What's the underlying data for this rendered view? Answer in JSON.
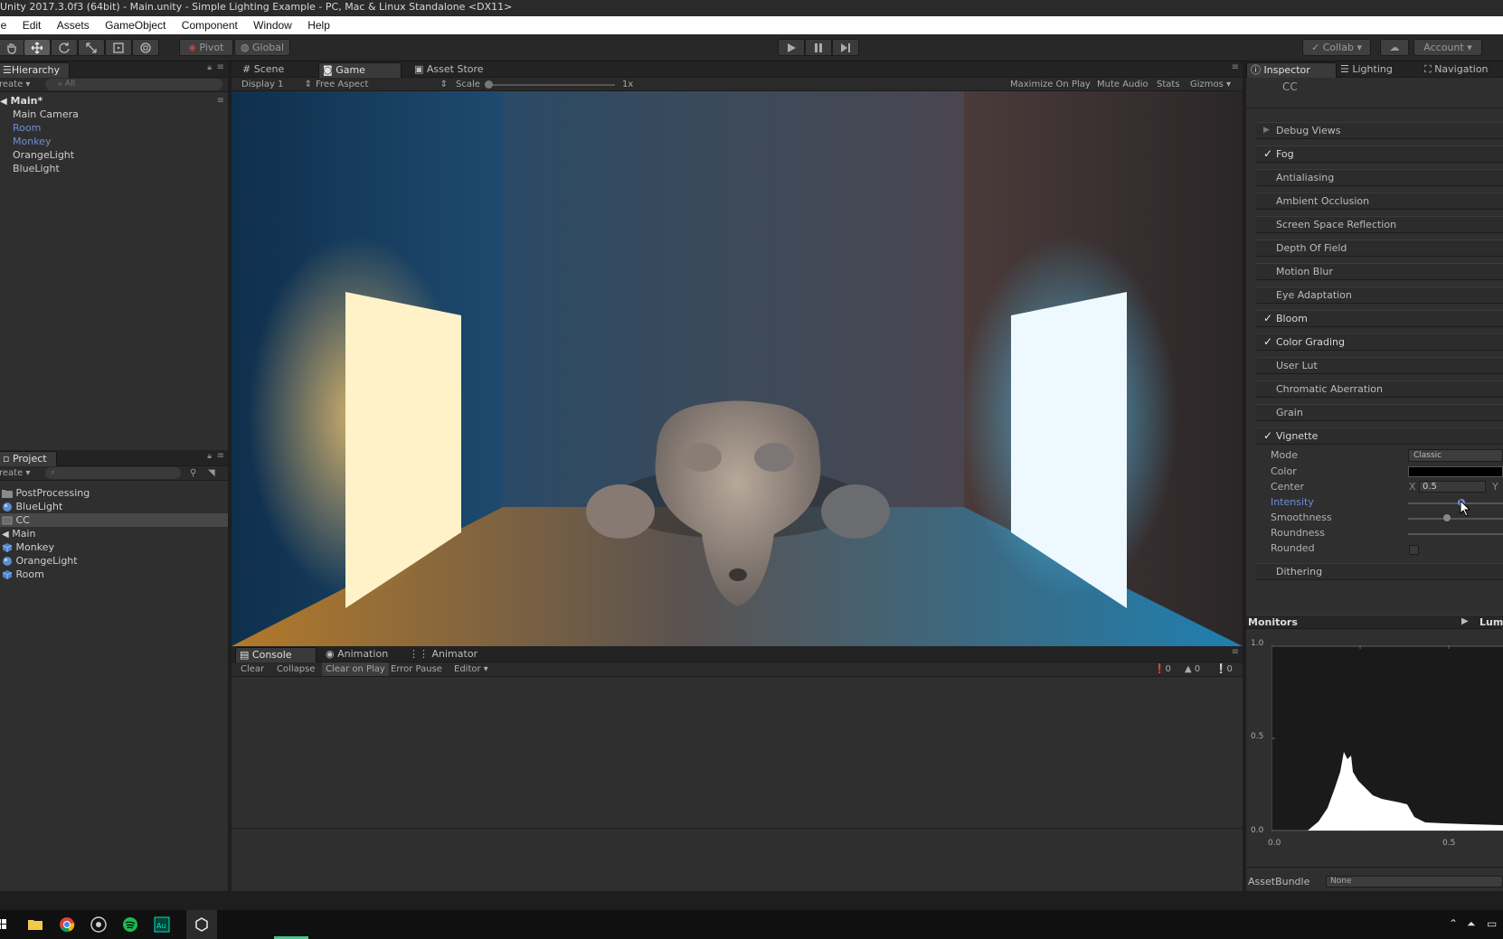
{
  "window": {
    "title": "Unity 2017.3.0f3 (64bit) - Main.unity - Simple Lighting Example - PC, Mac & Linux Standalone <DX11>"
  },
  "menu": [
    "le",
    "Edit",
    "Assets",
    "GameObject",
    "Component",
    "Window",
    "Help"
  ],
  "toolbar": {
    "pivot_label": "Pivot",
    "global_label": "Global",
    "collab_label": "Collab",
    "account_label": "Account"
  },
  "hierarchy": {
    "tab_label": "Hierarchy",
    "create_label": "reate",
    "search_placeholder": "All",
    "scene_name": "Main*",
    "items": [
      {
        "label": "Main Camera",
        "prefab": false
      },
      {
        "label": "Room",
        "prefab": true
      },
      {
        "label": "Monkey",
        "prefab": true
      },
      {
        "label": "OrangeLight",
        "prefab": false
      },
      {
        "label": "BlueLight",
        "prefab": false
      }
    ]
  },
  "project": {
    "tab_label": "Project",
    "create_label": "reate",
    "items": [
      {
        "label": "PostProcessing",
        "icon": "folder-icon"
      },
      {
        "label": "BlueLight",
        "icon": "material-icon"
      },
      {
        "label": "CC",
        "icon": "postprocess-profile-icon",
        "selected": true
      },
      {
        "label": "Main",
        "icon": "unity-scene-icon"
      },
      {
        "label": "Monkey",
        "icon": "prefab-icon"
      },
      {
        "label": "OrangeLight",
        "icon": "material-icon"
      },
      {
        "label": "Room",
        "icon": "prefab-icon"
      }
    ]
  },
  "view_tabs": {
    "scene": "Scene",
    "game": "Game",
    "asset_store": "Asset Store"
  },
  "game_bar": {
    "display": "Display 1",
    "aspect": "Free Aspect",
    "scale_label": "Scale",
    "scale_value": "1x",
    "maximize": "Maximize On Play",
    "mute": "Mute Audio",
    "stats": "Stats",
    "gizmos": "Gizmos"
  },
  "console": {
    "tabs": [
      "Console",
      "Animation",
      "Animator"
    ],
    "buttons": [
      "Clear",
      "Collapse",
      "Clear on Play",
      "Error Pause",
      "Editor"
    ],
    "counts": {
      "info": "0",
      "warn": "0",
      "error": "0"
    }
  },
  "inspector": {
    "tabs": [
      "Inspector",
      "Lighting",
      "Navigation"
    ],
    "object_name": "CC",
    "sections": [
      {
        "label": "Debug Views",
        "enabled": false,
        "arrow": true
      },
      {
        "label": "Fog",
        "enabled": true
      },
      {
        "label": "Antialiasing",
        "enabled": false
      },
      {
        "label": "Ambient Occlusion",
        "enabled": false
      },
      {
        "label": "Screen Space Reflection",
        "enabled": false
      },
      {
        "label": "Depth Of Field",
        "enabled": false
      },
      {
        "label": "Motion Blur",
        "enabled": false
      },
      {
        "label": "Eye Adaptation",
        "enabled": false
      },
      {
        "label": "Bloom",
        "enabled": true
      },
      {
        "label": "Color Grading",
        "enabled": true
      },
      {
        "label": "User Lut",
        "enabled": false
      },
      {
        "label": "Chromatic Aberration",
        "enabled": false
      },
      {
        "label": "Grain",
        "enabled": false
      },
      {
        "label": "Vignette",
        "enabled": true
      }
    ],
    "vignette": {
      "mode_label": "Mode",
      "mode_value": "Classic",
      "color_label": "Color",
      "center_label": "Center",
      "center_x_label": "X",
      "center_x": "0.5",
      "center_y_label": "Y",
      "intensity_label": "Intensity",
      "smoothness_label": "Smoothness",
      "roundness_label": "Roundness",
      "rounded_label": "Rounded"
    },
    "dithering_label": "Dithering"
  },
  "monitors": {
    "label": "Monitors",
    "mode": "Lum",
    "y_ticks": [
      "1.0",
      "0.5",
      "0.0"
    ],
    "x_ticks": [
      "0.0",
      "0.5"
    ]
  },
  "assetbundle": {
    "label": "AssetBundle",
    "value": "None"
  },
  "colors": {
    "accent_blue": "#6f8fd8",
    "panel_bg": "#2f2f2f",
    "selection": "#3e4a5e"
  }
}
